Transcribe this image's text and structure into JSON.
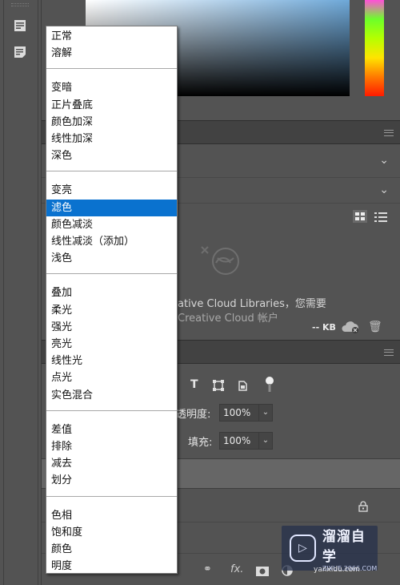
{
  "lib_panel": {
    "message": "ative Cloud Libraries，您需要",
    "message2": "Creative Cloud 帐户",
    "size_label": "-- KB"
  },
  "layers_panel": {
    "opacity_label": "透明度:",
    "opacity_value": "100%",
    "fill_label": "填充:",
    "fill_value": "100%"
  },
  "watermark": {
    "title": "溜溜自学",
    "subtitle": "ZIXUE.3066.COM",
    "partial_text": "yanxidu.com"
  },
  "blend_menu": {
    "groups": [
      [
        "正常",
        "溶解"
      ],
      [
        "变暗",
        "正片叠底",
        "颜色加深",
        "线性加深",
        "深色"
      ],
      [
        "变亮",
        "滤色",
        "颜色减淡",
        "线性减淡（添加）",
        "浅色"
      ],
      [
        "叠加",
        "柔光",
        "强光",
        "亮光",
        "线性光",
        "点光",
        "实色混合"
      ],
      [
        "差值",
        "排除",
        "减去",
        "划分"
      ],
      [
        "色相",
        "饱和度",
        "颜色",
        "明度"
      ]
    ],
    "selected": "滤色"
  },
  "colors": {
    "panel_bg": "#535353",
    "header_bg": "#424242",
    "menu_highlight": "#0a72cf"
  }
}
